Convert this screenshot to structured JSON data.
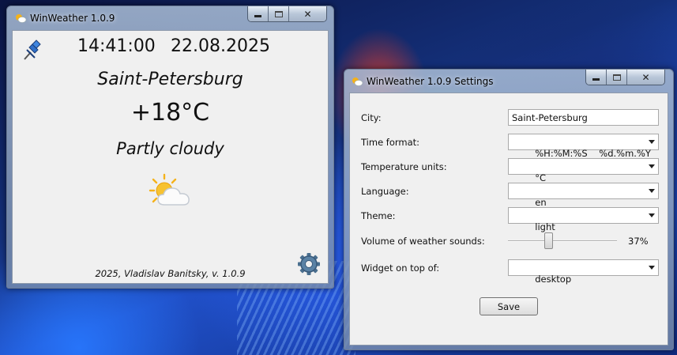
{
  "widget": {
    "title": "WinWeather 1.0.9",
    "time": "14:41:00",
    "date": "22.08.2025",
    "city": "Saint-Petersburg",
    "temperature": "+18°C",
    "condition": "Partly cloudy",
    "footer": "2025, Vladislav Banitsky, v. 1.0.9",
    "icons": {
      "app": "weather-app-icon",
      "pin": "pushpin-icon",
      "weather": "partly-cloudy-icon",
      "settings": "gear-icon"
    }
  },
  "settings": {
    "title": "WinWeather 1.0.9 Settings",
    "city": {
      "label": "City:",
      "value": "Saint-Petersburg"
    },
    "time_format": {
      "label": "Time format:",
      "value": "%H:%M:%S    %d.%m.%Y"
    },
    "temperature_units": {
      "label": "Temperature units:",
      "value": "°C"
    },
    "language": {
      "label": "Language:",
      "value": "en"
    },
    "theme": {
      "label": "Theme:",
      "value": "light"
    },
    "volume": {
      "label": "Volume of weather sounds:",
      "value_text": "37%",
      "value": 0.37
    },
    "on_top": {
      "label": "Widget on top of:",
      "value": "desktop"
    },
    "save_label": "Save"
  },
  "window_controls": {
    "minimize": "minimize-icon",
    "maximize": "maximize-icon",
    "close": "close-icon"
  },
  "colors": {
    "client_bg": "#f0f0f0",
    "sun": "#f5b21a",
    "gear": "#4a6f8f"
  }
}
